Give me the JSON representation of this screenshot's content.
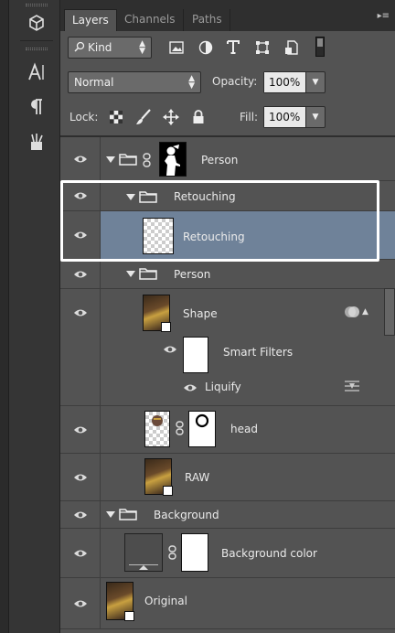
{
  "tabs": [
    {
      "label": "Layers",
      "active": true
    },
    {
      "label": "Channels",
      "active": false
    },
    {
      "label": "Paths",
      "active": false
    }
  ],
  "filter": {
    "kind_label": "Kind"
  },
  "blend": {
    "mode": "Normal",
    "opacity_label": "Opacity:",
    "opacity_value": "100%"
  },
  "lock": {
    "label": "Lock:",
    "fill_label": "Fill:",
    "fill_value": "100%"
  },
  "layers": [
    {
      "name": "Person",
      "type": "group-masked",
      "indent": 0
    },
    {
      "name": "Retouching",
      "type": "group",
      "indent": 1
    },
    {
      "name": "Retouching",
      "type": "pixel",
      "indent": 1,
      "selected": true
    },
    {
      "name": "Person",
      "type": "group",
      "indent": 1
    },
    {
      "name": "Shape",
      "type": "smart-object",
      "indent": 1
    },
    {
      "name": "Smart Filters",
      "type": "smart-filters",
      "indent": 2
    },
    {
      "name": "Liquify",
      "type": "filter",
      "indent": 2
    },
    {
      "name": "head",
      "type": "masked",
      "indent": 1
    },
    {
      "name": "RAW",
      "type": "smart-object",
      "indent": 1
    },
    {
      "name": "Background",
      "type": "group",
      "indent": 0
    },
    {
      "name": "Background color",
      "type": "fill-masked",
      "indent": 1
    },
    {
      "name": "Original",
      "type": "smart-object",
      "indent": 0
    }
  ],
  "colors": {
    "selected_row": "#6f8299",
    "panel": "#535353",
    "highlight": "#ffffff"
  }
}
